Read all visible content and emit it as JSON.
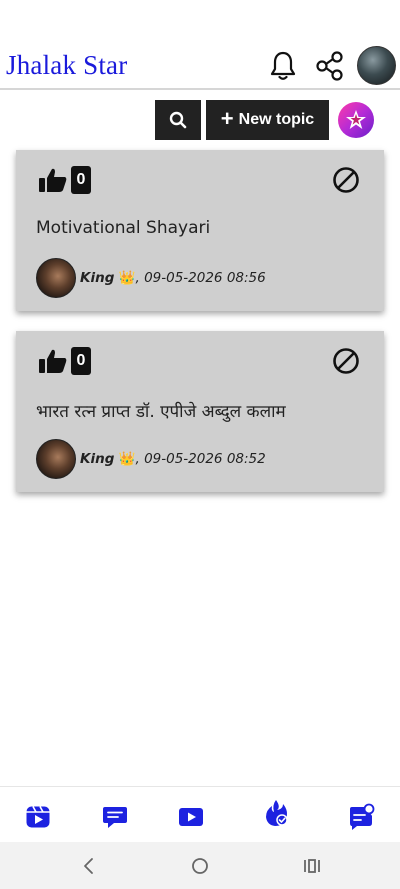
{
  "app": {
    "title": "Jhalak Star"
  },
  "header": {
    "icons": [
      "bell-icon",
      "share-icon",
      "profile-avatar"
    ]
  },
  "toolbar": {
    "new_topic_label": "New topic",
    "search_icon": "search-icon"
  },
  "topics": [
    {
      "likes": "0",
      "title": "Motivational Shayari",
      "user": "King",
      "user_badge": "👑",
      "timestamp": ", 09-05-2026 08:56"
    },
    {
      "likes": "0",
      "title": "भारत रत्न प्राप्त डॉ. एपीजे अब्दुल कलाम",
      "user": "King",
      "user_badge": "👑",
      "timestamp": ", 09-05-2026 08:52"
    }
  ],
  "bottom_nav": {
    "items": [
      "reels-icon",
      "chat-icon",
      "video-icon",
      "trending-icon",
      "support-icon"
    ]
  },
  "colors": {
    "brand_blue": "#1a1adb",
    "nav_blue": "#1d22e0",
    "card_bg": "#cfcfcf",
    "button_dark": "#222222"
  }
}
